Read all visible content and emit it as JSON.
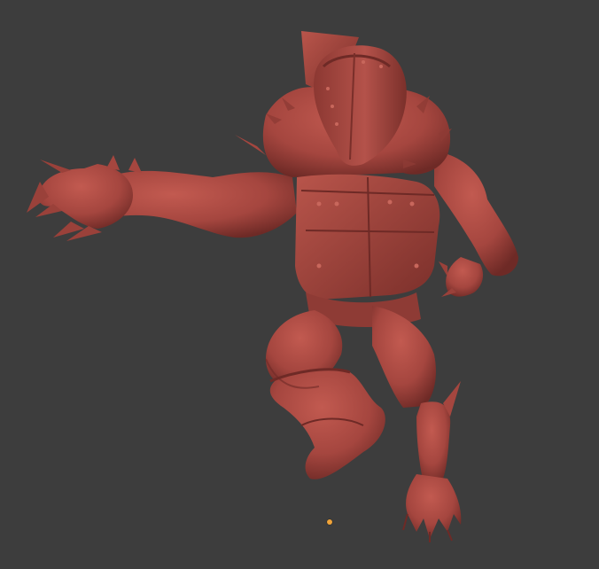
{
  "viewport": {
    "background": "#3d3d3d",
    "model": {
      "kind": "sculpted creature figure",
      "material_color": "#a5463f",
      "shadow_color": "#6e2a26",
      "highlight_color": "#c25a50"
    },
    "origin_marker": {
      "icon": "origin-dot-icon",
      "color": "#f0a43a"
    }
  }
}
